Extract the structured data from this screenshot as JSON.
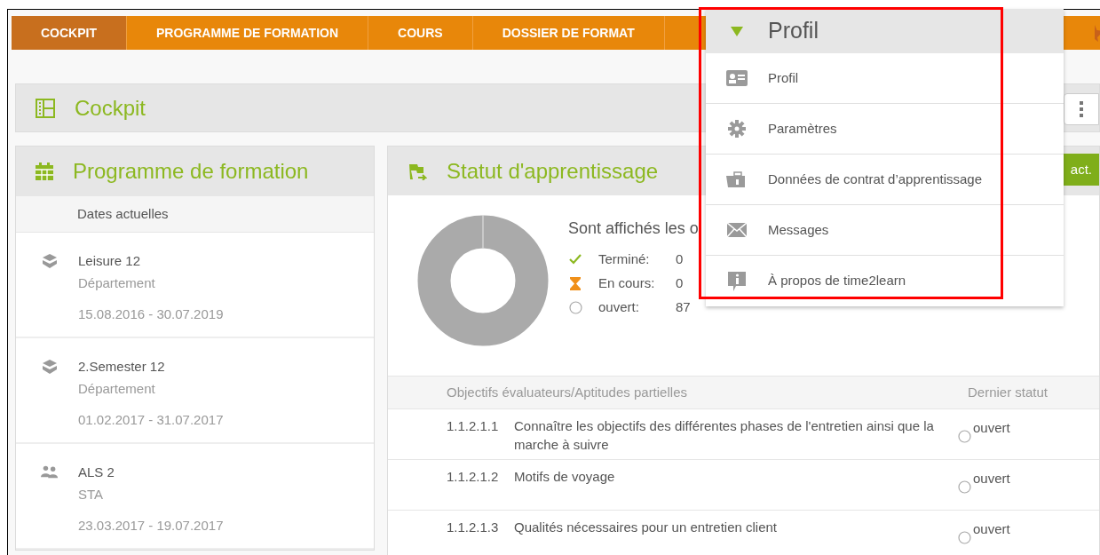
{
  "nav": {
    "tabs": [
      {
        "label": "COCKPIT",
        "selected": true
      },
      {
        "label": "PROGRAMME DE FORMATION",
        "selected": false
      },
      {
        "label": "COURS",
        "selected": false
      },
      {
        "label": "DOSSIER DE FORMAT",
        "selected": false
      }
    ]
  },
  "page_title": "Cockpit",
  "programme": {
    "title": "Programme de formation",
    "subheader": "Dates actuelles",
    "items": [
      {
        "kind": "department",
        "name": "Leisure 12",
        "type": "Département",
        "dates": "15.08.2016 - 30.07.2019"
      },
      {
        "kind": "department",
        "name": "2.Semester 12",
        "type": "Département",
        "dates": "01.02.2017 - 31.07.2017"
      },
      {
        "kind": "group",
        "name": "ALS 2",
        "type": "STA",
        "dates": "23.03.2017 - 19.07.2017"
      }
    ]
  },
  "status": {
    "title": "Statut d'apprentissage",
    "action_button": "act.",
    "intro": "Sont affichés les o",
    "legend": [
      {
        "kind": "done",
        "label": "Terminé:",
        "count": "0"
      },
      {
        "kind": "progress",
        "label": "En cours:",
        "count": "0"
      },
      {
        "kind": "open",
        "label": "ouvert:",
        "count": "87"
      }
    ],
    "table": {
      "columns": [
        "Objectifs évaluateurs/Aptitudes partielles",
        "Dernier statut"
      ],
      "rows": [
        {
          "number": "1.1.2.1.1",
          "text": "Connaître les objectifs des différentes phases de l'entretien ainsi que la marche à suivre",
          "status": "ouvert"
        },
        {
          "number": "1.1.2.1.2",
          "text": "Motifs de voyage",
          "status": "ouvert"
        },
        {
          "number": "1.1.2.1.3",
          "text": "Qualités nécessaires pour un entretien client",
          "status": "ouvert"
        }
      ]
    }
  },
  "profile_menu": {
    "title": "Profil",
    "items": [
      {
        "kind": "card",
        "label": "Profil"
      },
      {
        "kind": "gear",
        "label": "Paramètres"
      },
      {
        "kind": "contract",
        "label": "Données de contrat d’apprentissage"
      },
      {
        "kind": "mail",
        "label": "Messages"
      },
      {
        "kind": "info",
        "label": "À propos de time2learn"
      }
    ]
  }
}
